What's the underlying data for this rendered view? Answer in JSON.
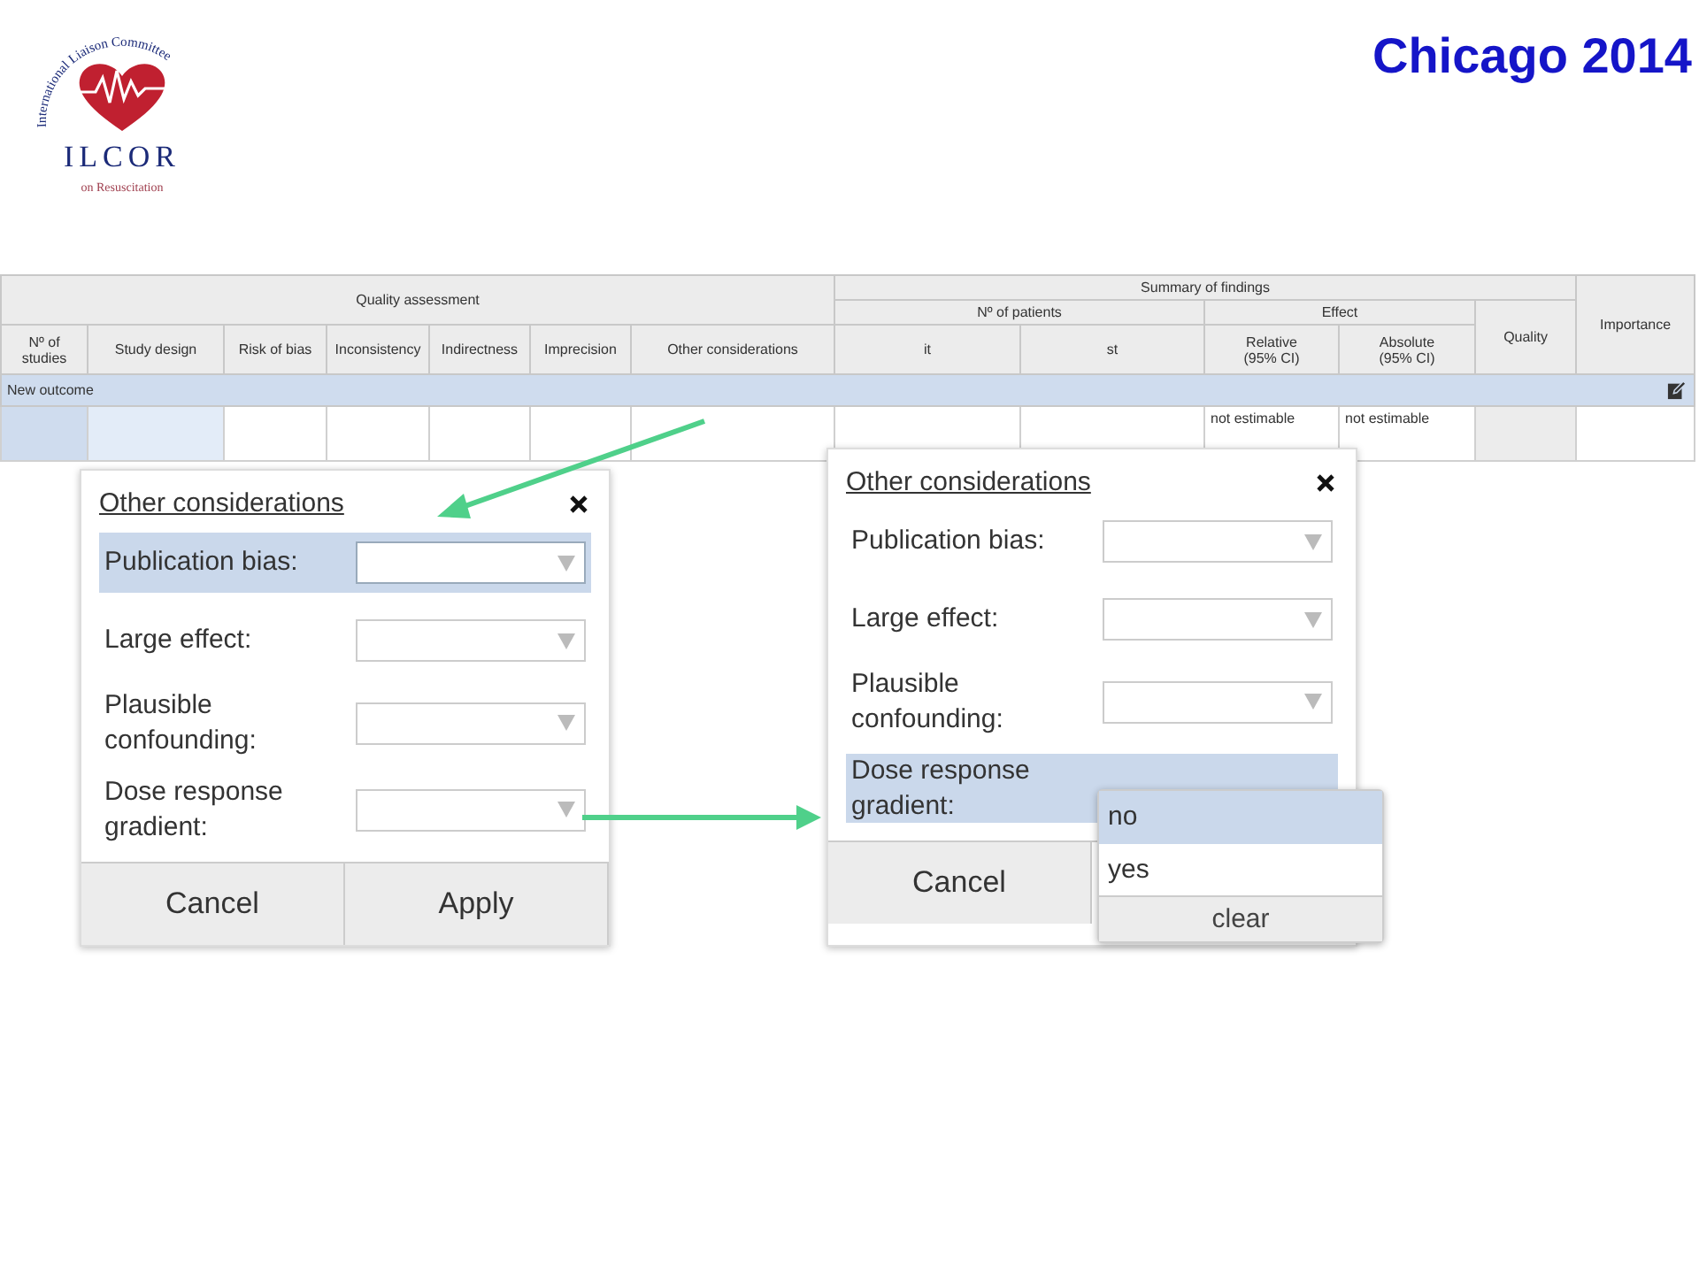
{
  "slide": {
    "title": "Chicago 2014",
    "logo": {
      "arc_text": "International Liaison Committee",
      "name": "ILCOR",
      "subtitle": "on Resuscitation"
    }
  },
  "table": {
    "groups": [
      "Quality assessment",
      "Summary of findings"
    ],
    "quality_columns": [
      "Nº of\nstudies",
      "Study design",
      "Risk of bias",
      "Inconsistency",
      "Indirectness",
      "Imprecision",
      "Other considerations"
    ],
    "patients_header": "Nº of patients",
    "patient_columns": [
      "it",
      "st"
    ],
    "effect_header": "Effect",
    "effect_columns": [
      "Relative\n(95% CI)",
      "Absolute\n(95% CI)"
    ],
    "quality_header": "Quality",
    "importance_header": "Importance",
    "section": "New outcome",
    "row": {
      "relative": "not estimable",
      "absolute": "not estimable"
    }
  },
  "dialogs": [
    {
      "title": "Other considerations",
      "fields": [
        {
          "label": "Publication bias:",
          "selected": true
        },
        {
          "label": "Large effect:",
          "selected": false
        },
        {
          "label": "Plausible\nconfounding:",
          "selected": false
        },
        {
          "label": "Dose response\ngradient:",
          "selected": false
        }
      ],
      "buttons": [
        "Cancel",
        "Apply"
      ]
    },
    {
      "title": "Other considerations",
      "fields": [
        {
          "label": "Publication bias:",
          "selected": false
        },
        {
          "label": "Large effect:",
          "selected": false
        },
        {
          "label": "Plausible\nconfounding:",
          "selected": false
        },
        {
          "label": "Dose response\ngradient:",
          "selected": true,
          "dropdown": {
            "options": [
              {
                "label": "no",
                "selected": true
              },
              {
                "label": "yes",
                "selected": false
              }
            ],
            "clear": "clear"
          }
        }
      ],
      "buttons": [
        "Cancel"
      ]
    }
  ]
}
